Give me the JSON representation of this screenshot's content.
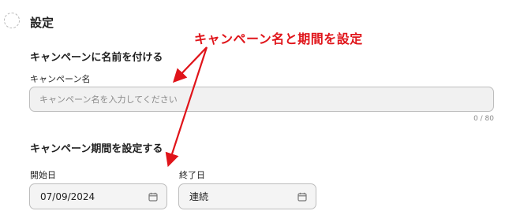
{
  "section": {
    "title": "設定"
  },
  "annotation": {
    "text": "キャンペーン名と期間を設定",
    "color": "#e0141a"
  },
  "campaign_name": {
    "heading": "キャンペーンに名前を付ける",
    "label": "キャンペーン名",
    "value": "",
    "placeholder": "キャンペーン名を入力してください",
    "counter": "0 / 80"
  },
  "campaign_period": {
    "heading": "キャンペーン期間を設定する",
    "start_label": "開始日",
    "start_value": "07/09/2024",
    "end_label": "終了日",
    "end_value": "連続",
    "icon": "calendar-icon"
  }
}
